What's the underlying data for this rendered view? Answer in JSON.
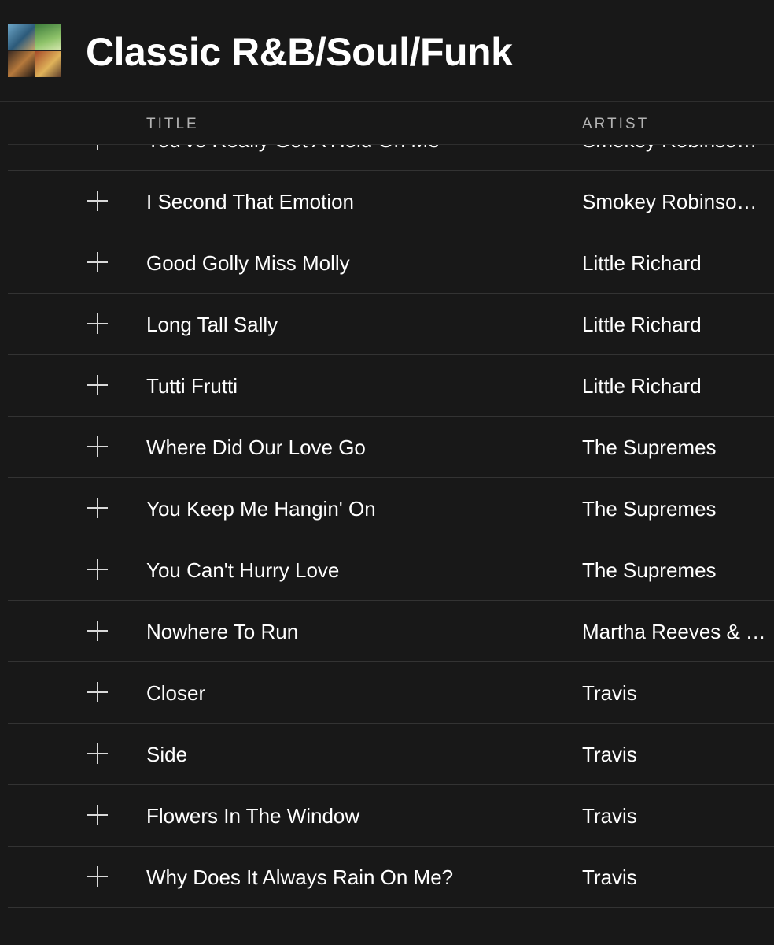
{
  "playlist": {
    "title": "Classic R&B/Soul/Funk",
    "cover_icon": "playlist-mosaic-cover"
  },
  "columns": {
    "title": "TITLE",
    "artist": "ARTIST"
  },
  "colors": {
    "background": "#181818",
    "text": "#ffffff",
    "muted": "#b3b3b3",
    "divider": "#333333"
  },
  "icons": {
    "add": "plus-icon"
  },
  "tracks": [
    {
      "title": "You've Really Got A Hold On Me",
      "artist": "Smokey Robinson & The Miracles"
    },
    {
      "title": "I Second That Emotion",
      "artist": "Smokey Robinson & The Miracles"
    },
    {
      "title": "Good Golly Miss Molly",
      "artist": "Little Richard"
    },
    {
      "title": "Long Tall Sally",
      "artist": "Little Richard"
    },
    {
      "title": "Tutti Frutti",
      "artist": "Little Richard"
    },
    {
      "title": "Where Did Our Love Go",
      "artist": "The Supremes"
    },
    {
      "title": "You Keep Me Hangin' On",
      "artist": "The Supremes"
    },
    {
      "title": "You Can't Hurry Love",
      "artist": "The Supremes"
    },
    {
      "title": "Nowhere To Run",
      "artist": "Martha Reeves & The Vandellas"
    },
    {
      "title": "Closer",
      "artist": "Travis"
    },
    {
      "title": "Side",
      "artist": "Travis"
    },
    {
      "title": "Flowers In The Window",
      "artist": "Travis"
    },
    {
      "title": "Why Does It Always Rain On Me?",
      "artist": "Travis"
    }
  ]
}
